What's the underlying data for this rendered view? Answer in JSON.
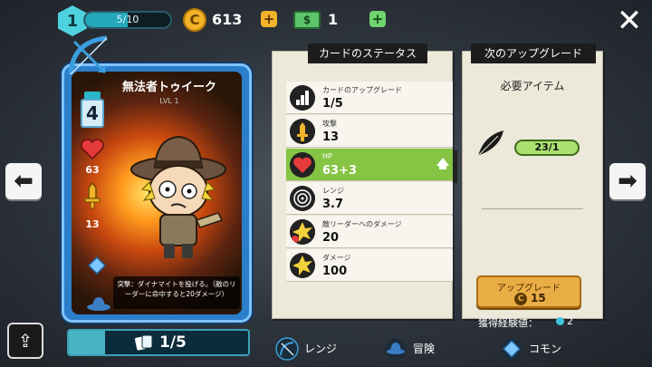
{
  "player": {
    "level": "1",
    "xp_text": "5/10",
    "xp_fraction": 0.5
  },
  "currency": {
    "coins": "613",
    "coin_symbol": "C",
    "cash": "1",
    "cash_symbol": "$"
  },
  "card": {
    "name": "無法者トゥイーク",
    "level": "LVL 1",
    "cost": "4",
    "hp": "63",
    "attack": "13",
    "description": "突撃：ダイナマイトを投げる。（敵のリーダーに命中すると20ダメージ）",
    "count_text": "1/5",
    "count_fraction": 0.2
  },
  "stats_panel": {
    "title": "カードのステータス",
    "rows": [
      {
        "label": "カードのアップグレード",
        "value": "1/5",
        "icon": "bars-icon",
        "active": false
      },
      {
        "label": "攻撃",
        "value": "13",
        "icon": "sword-icon",
        "active": false
      },
      {
        "label": "HP",
        "value": "63+3",
        "icon": "heart-icon",
        "active": true
      },
      {
        "label": "レンジ",
        "value": "3.7",
        "icon": "range-icon",
        "active": false
      },
      {
        "label": "敵リーダーへのダメージ",
        "value": "20",
        "icon": "leader-damage-icon",
        "active": false
      },
      {
        "label": "ダメージ",
        "value": "100",
        "icon": "damage-icon",
        "active": false
      }
    ]
  },
  "upgrade_panel": {
    "title": "次のアップグレード",
    "required_label": "必要アイテム",
    "required_count": "23/1",
    "button_label": "アップグレード",
    "button_cost": "15",
    "xp_gain_label": "獲得経験値：",
    "xp_gain_value": "2"
  },
  "tags": [
    {
      "label": "レンジ",
      "icon": "bow-icon"
    },
    {
      "label": "冒険",
      "icon": "cowboy-hat-icon"
    },
    {
      "label": "コモン",
      "icon": "gem-icon"
    }
  ],
  "colors": {
    "accent_teal": "#4fd2e0",
    "hp_active": "#86c443",
    "coin_gold": "#f1b428",
    "cash_green": "#5cc46b",
    "card_blue": "#2b7ec9",
    "upgrade_button": "#e9ad45"
  }
}
